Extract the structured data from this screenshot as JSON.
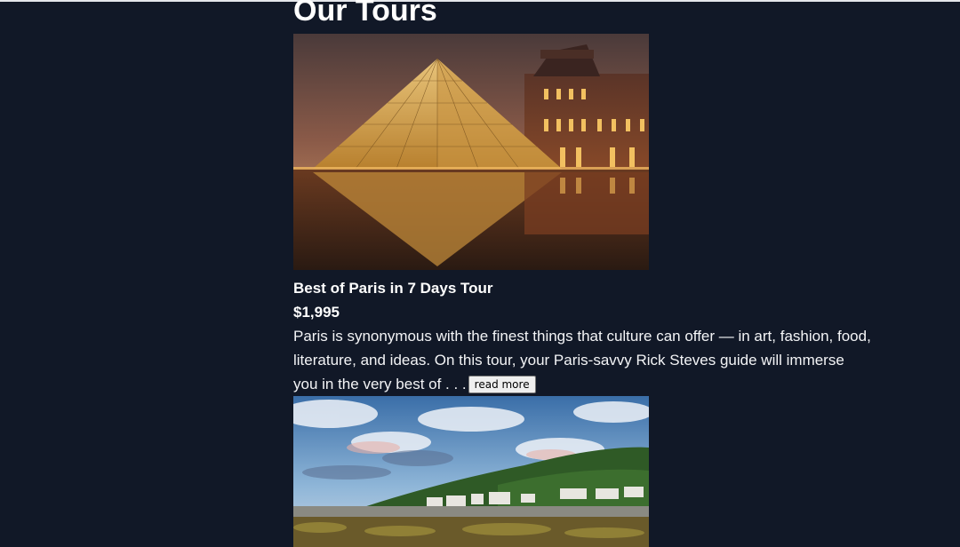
{
  "page": {
    "title": "Our Tours"
  },
  "tours": [
    {
      "name": "Best of Paris in 7 Days Tour",
      "price": "$1,995",
      "description": "Paris is synonymous with the finest things that culture can offer — in art, fashion, food, literature, and ideas. On this tour, your Paris-savvy Rick Steves guide will immerse you in the very best of . . .",
      "read_more_label": "read more",
      "image_alt": "Louvre pyramid at dusk"
    },
    {
      "image_alt": "Coastal village beneath green hills"
    }
  ],
  "colors": {
    "background": "#111827",
    "text": "#ffffff"
  }
}
